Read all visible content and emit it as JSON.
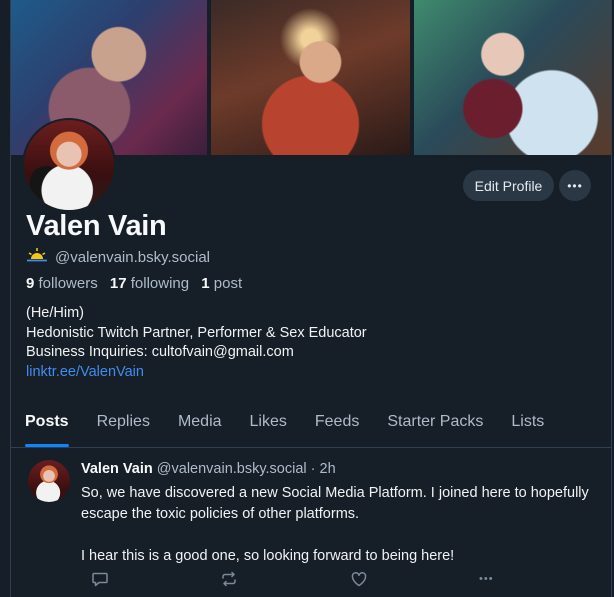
{
  "profile": {
    "display_name": "Valen Vain",
    "handle": "@valenvain.bsky.social",
    "followers_count": "9",
    "followers_label": "followers",
    "following_count": "17",
    "following_label": "following",
    "posts_count": "1",
    "posts_label": "post",
    "bio": {
      "pronouns": "(He/Him)",
      "line1": "Hedonistic Twitch Partner, Performer & Sex Educator",
      "line2": "Business Inquiries: cultofvain@gmail.com",
      "link": "linktr.ee/ValenVain"
    },
    "edit_profile_label": "Edit Profile",
    "more_label": "•••"
  },
  "tabs": [
    {
      "label": "Posts",
      "active": true
    },
    {
      "label": "Replies"
    },
    {
      "label": "Media"
    },
    {
      "label": "Likes"
    },
    {
      "label": "Feeds"
    },
    {
      "label": "Starter Packs"
    },
    {
      "label": "Lists"
    }
  ],
  "post": {
    "author_name": "Valen Vain",
    "author_handle": "@valenvain.bsky.social",
    "separator": "·",
    "time": "2h",
    "paragraph1": "So, we have discovered a new Social Media Platform. I joined here to hopefully escape the toxic policies of other platforms.",
    "paragraph2": "I hear this is a good one, so looking forward to being here!",
    "more_label": "•••"
  },
  "colors": {
    "background": "#161e27",
    "accent": "#1083fe",
    "link": "#3e8eef",
    "muted_text": "#aebbc9",
    "button_bg": "#2a3745",
    "handle_icon": "#f5c518"
  },
  "icons": {
    "handle_badge": "sun-icon",
    "reply": "reply-icon",
    "repost": "repost-icon",
    "like": "heart-icon",
    "more": "more-icon"
  }
}
